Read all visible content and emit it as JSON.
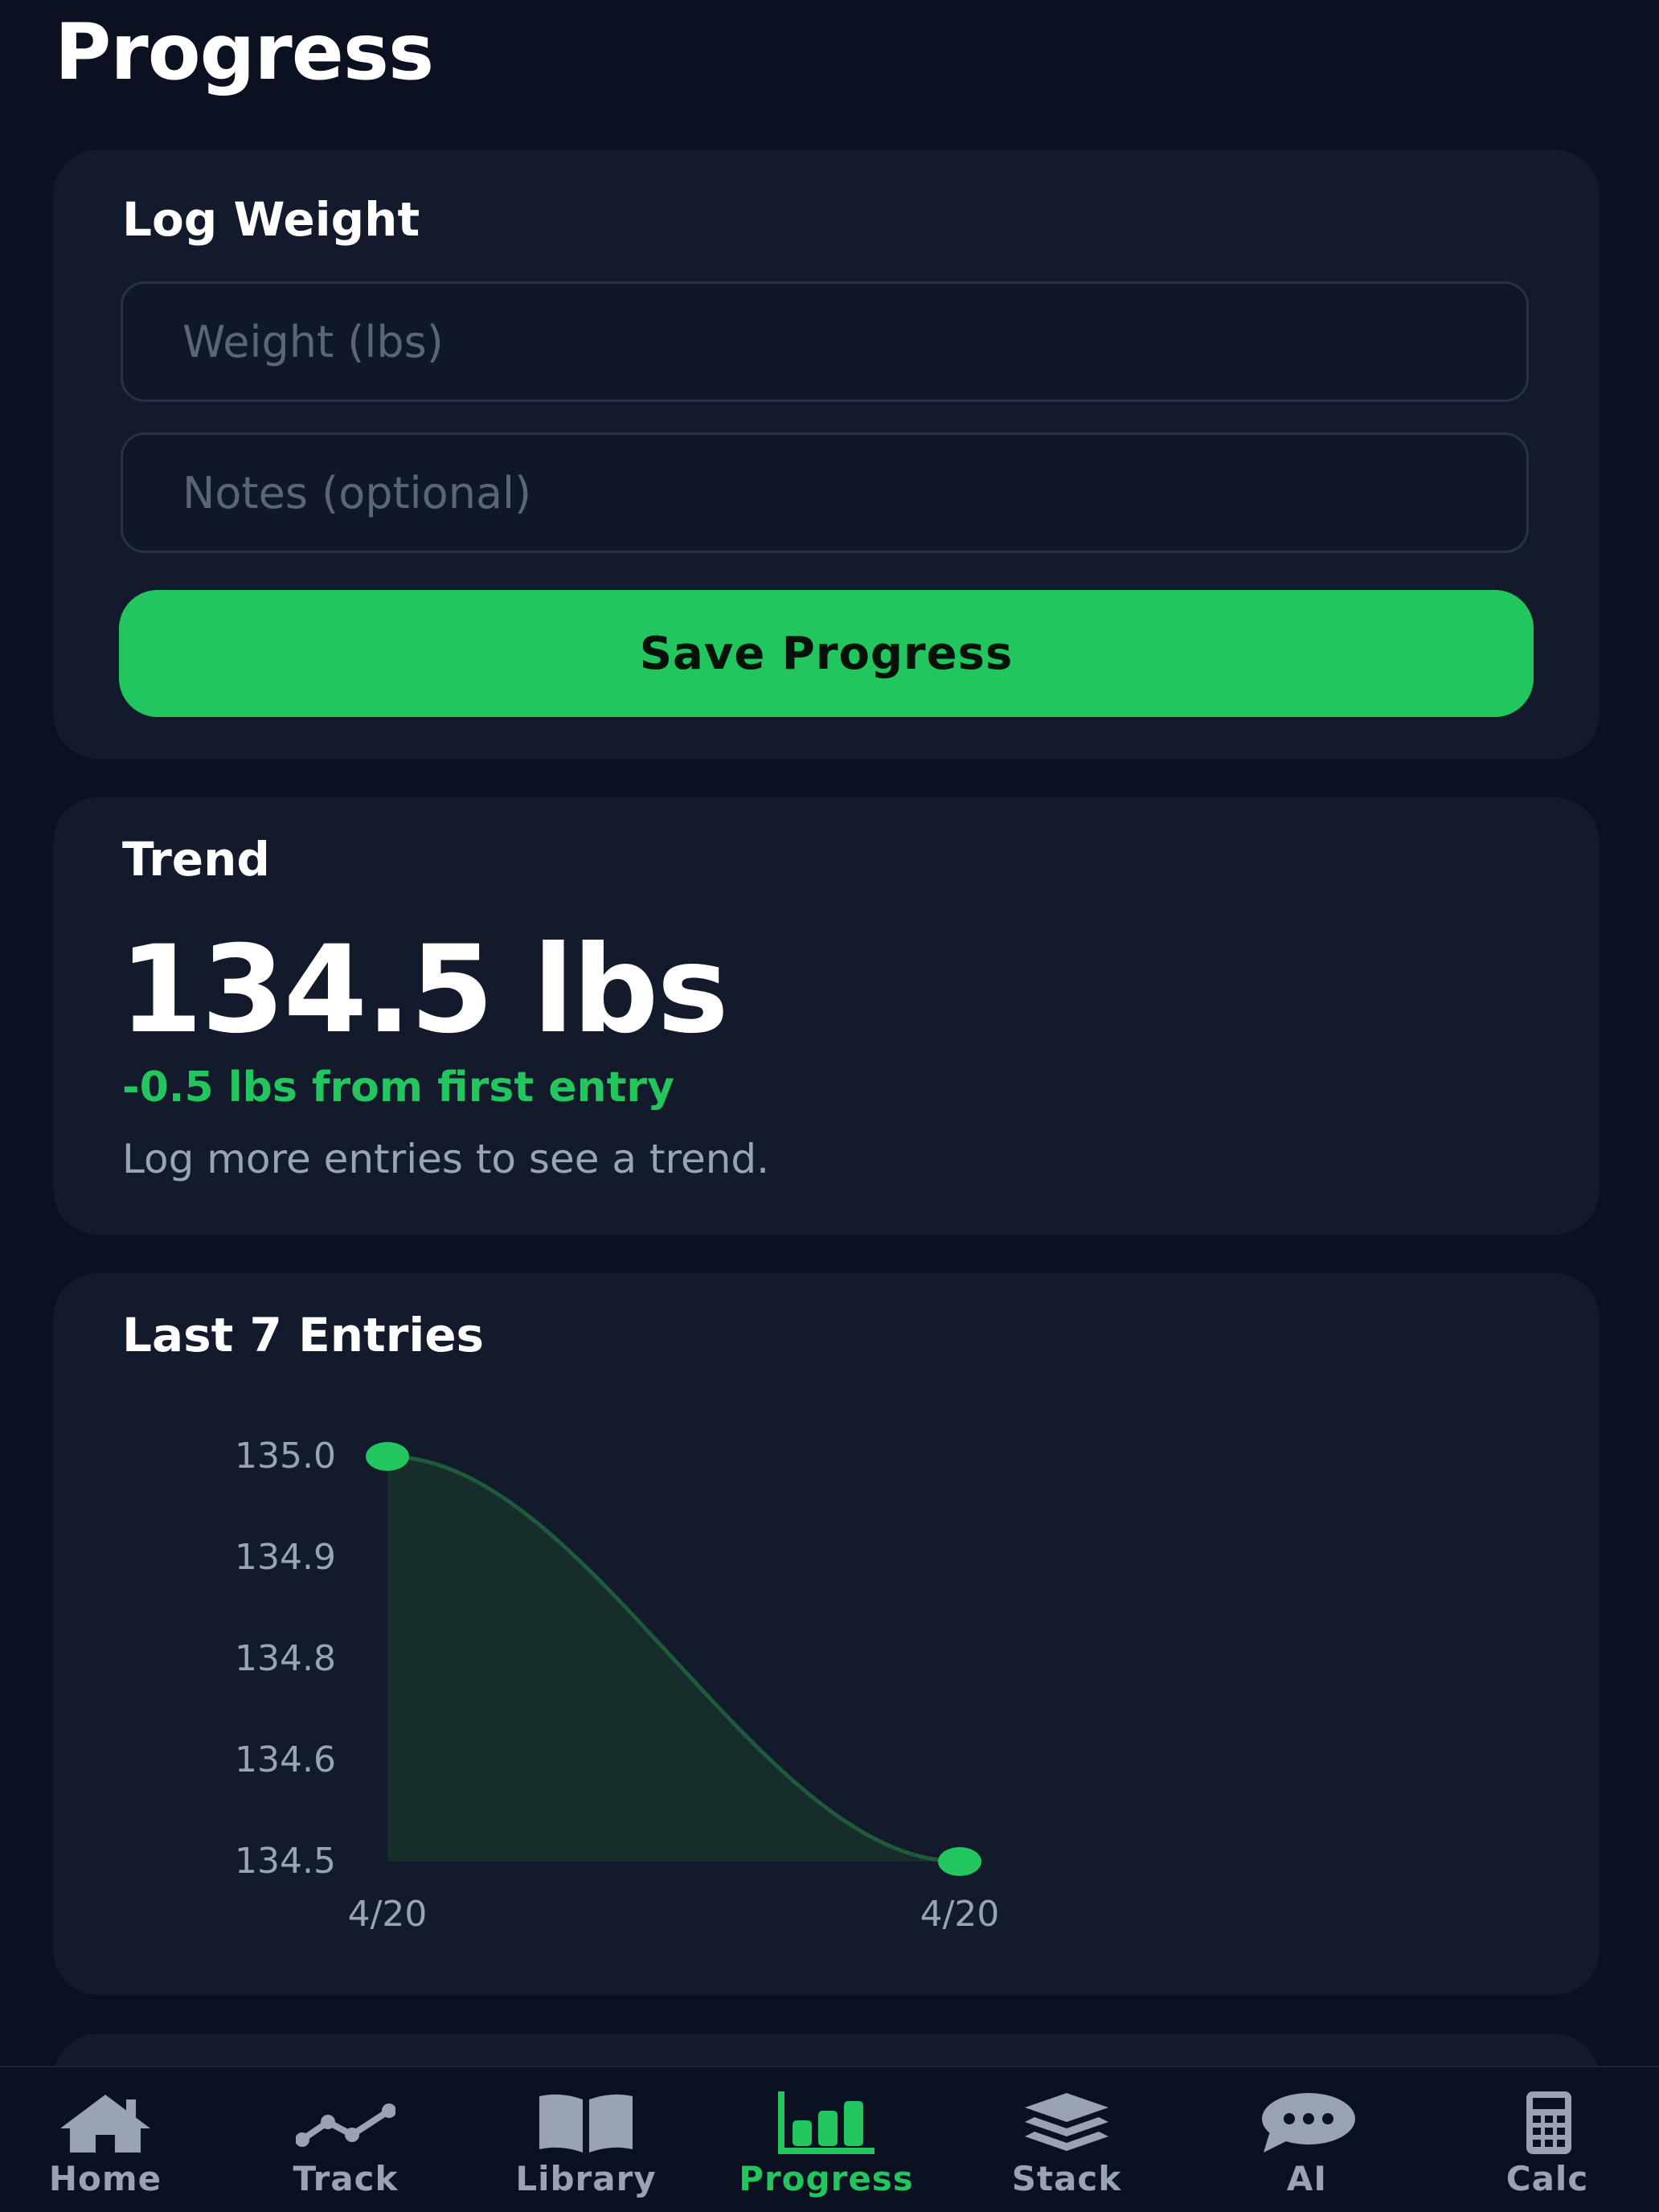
{
  "page": {
    "title": "Progress"
  },
  "log_weight": {
    "title": "Log Weight",
    "weight_placeholder": "Weight (lbs)",
    "weight_value": "",
    "notes_placeholder": "Notes (optional)",
    "notes_value": "",
    "save_label": "Save Progress"
  },
  "trend": {
    "title": "Trend",
    "value": "134.5 lbs",
    "change": "-0.5 lbs from first entry",
    "note": "Log more entries to see a trend."
  },
  "entries": {
    "title": "Last 7 Entries"
  },
  "chart_data": {
    "type": "area",
    "x": [
      "4/20",
      "4/20"
    ],
    "values": [
      135.0,
      134.5
    ],
    "y_ticks": [
      "135.0",
      "134.9",
      "134.8",
      "134.6",
      "134.5"
    ],
    "ylim": [
      134.5,
      135.0
    ],
    "grid": false,
    "color": "#22c55e"
  },
  "colors": {
    "accent": "#22c55e",
    "background": "#0b1120",
    "card": "#121a2b",
    "muted": "#9aa3b2"
  },
  "tabbar": {
    "items": [
      {
        "label": "Home",
        "icon": "home-icon"
      },
      {
        "label": "Track",
        "icon": "trend-line-icon"
      },
      {
        "label": "Library",
        "icon": "book-icon"
      },
      {
        "label": "Progress",
        "icon": "bar-chart-icon",
        "active": true
      },
      {
        "label": "Stack",
        "icon": "layers-icon"
      },
      {
        "label": "AI",
        "icon": "chat-bubble-icon"
      },
      {
        "label": "Calc",
        "icon": "calculator-icon"
      }
    ]
  }
}
